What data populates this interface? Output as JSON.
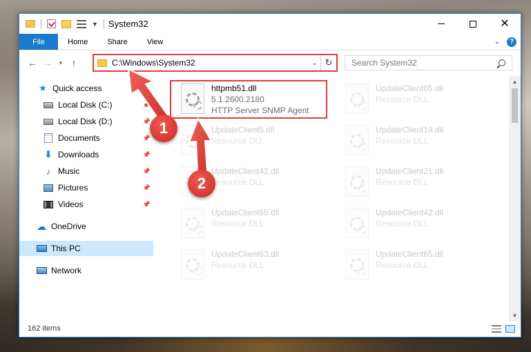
{
  "window": {
    "title": "System32",
    "controls": {
      "minimize": "",
      "maximize": "",
      "close": "✕"
    }
  },
  "ribbon": {
    "tabs": [
      "File",
      "Home",
      "Share",
      "View"
    ],
    "expand_icon": "chevron-down-icon",
    "help": "?"
  },
  "nav": {
    "back": "←",
    "forward": "→",
    "recent": "▾",
    "up": "↑",
    "address": "C:\\Windows\\System32",
    "address_dropdown": "⌄",
    "refresh": "↻",
    "search_placeholder": "Search System32"
  },
  "sidebar": {
    "items": [
      {
        "label": "Quick access",
        "icon": "star-icon"
      },
      {
        "label": "Local Disk (C:)",
        "icon": "disk-icon"
      },
      {
        "label": "Local Disk (D:)",
        "icon": "disk-icon"
      },
      {
        "label": "Documents",
        "icon": "documents-icon"
      },
      {
        "label": "Downloads",
        "icon": "download-icon"
      },
      {
        "label": "Music",
        "icon": "music-icon"
      },
      {
        "label": "Pictures",
        "icon": "pictures-icon"
      },
      {
        "label": "Videos",
        "icon": "videos-icon"
      },
      {
        "label": "OneDrive",
        "icon": "cloud-icon"
      },
      {
        "label": "This PC",
        "icon": "computer-icon"
      },
      {
        "label": "Network",
        "icon": "network-icon"
      }
    ],
    "pin": "📌"
  },
  "files": {
    "highlighted": {
      "name": "httpmb51.dll",
      "version": "5.1.2600.2180",
      "description": "HTTP Server SNMP Agent"
    },
    "left_column": [
      {
        "name": "UpdateClient5.dll",
        "type": "Resource DLL"
      },
      {
        "name": "UpdateClient42.dll",
        "type": "Resource DLL"
      },
      {
        "name": "UpdateClient65.dll",
        "type": "Resource DLL"
      },
      {
        "name": "UpdateClient63.dll",
        "type": "Resource DLL"
      }
    ],
    "right_column": [
      {
        "name": "UpdateClient65.dll",
        "type": "Resource DLL"
      },
      {
        "name": "UpdateClient19.dll",
        "type": "Resource DLL"
      },
      {
        "name": "UpdateClient21.dll",
        "type": "Resource DLL"
      },
      {
        "name": "UpdateClient42.dll",
        "type": "Resource DLL"
      },
      {
        "name": "UpdateClient65.dll",
        "type": "Resource DLL"
      }
    ]
  },
  "status": {
    "count": "162 items"
  },
  "callouts": {
    "one": "1",
    "two": "2"
  },
  "colors": {
    "accent": "#1979ca",
    "highlight": "#e03a3a",
    "selected": "#cce8ff"
  }
}
